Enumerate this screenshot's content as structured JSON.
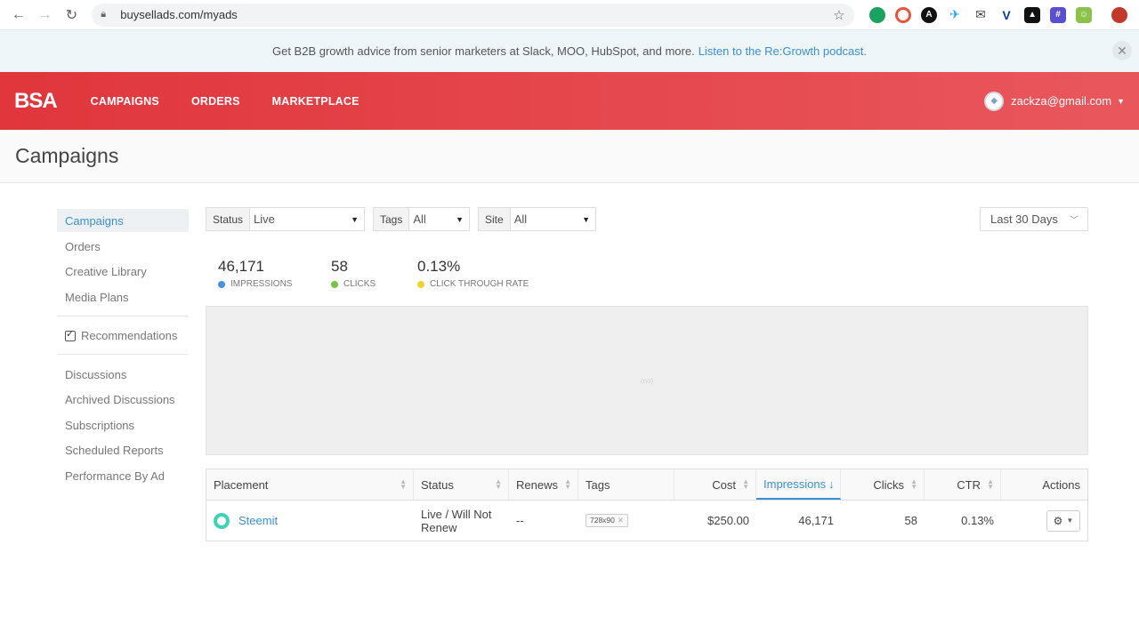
{
  "browser": {
    "url": "buysellads.com/myads"
  },
  "announcement": {
    "text": "Get B2B growth advice from senior marketers at Slack, MOO, HubSpot, and more.",
    "link": "Listen to the Re:Growth podcast."
  },
  "header": {
    "logo": "BSA",
    "nav": [
      "CAMPAIGNS",
      "ORDERS",
      "MARKETPLACE"
    ],
    "user_email": "zackza@gmail.com"
  },
  "page": {
    "title": "Campaigns"
  },
  "sidebar": {
    "group1": [
      "Campaigns",
      "Orders",
      "Creative Library",
      "Media Plans"
    ],
    "recommendations": "Recommendations",
    "group2": [
      "Discussions",
      "Archived Discussions",
      "Subscriptions",
      "Scheduled Reports",
      "Performance By Ad"
    ]
  },
  "filters": {
    "status": {
      "label": "Status",
      "value": "Live"
    },
    "tags": {
      "label": "Tags",
      "value": "All"
    },
    "site": {
      "label": "Site",
      "value": "All"
    },
    "date_range": "Last 30 Days"
  },
  "stats": {
    "impressions": {
      "value": "46,171",
      "label": "IMPRESSIONS",
      "color": "#4a90e2"
    },
    "clicks": {
      "value": "58",
      "label": "CLICKS",
      "color": "#7ac143"
    },
    "ctr": {
      "value": "0.13%",
      "label": "CLICK THROUGH RATE",
      "color": "#f0d22b"
    }
  },
  "chart": {
    "placeholder": "(no)"
  },
  "table": {
    "headers": [
      "Placement",
      "Status",
      "Renews",
      "Tags",
      "Cost",
      "Impressions",
      "Clicks",
      "CTR",
      "Actions"
    ],
    "rows": [
      {
        "placement": "Steemit",
        "status": "Live / Will Not Renew",
        "renews": "--",
        "tag": "728x90",
        "cost": "$250.00",
        "impressions": "46,171",
        "clicks": "58",
        "ctr": "0.13%"
      }
    ]
  },
  "colors": {
    "brand_red": "#e0363c",
    "link_blue": "#3a8fd6"
  }
}
